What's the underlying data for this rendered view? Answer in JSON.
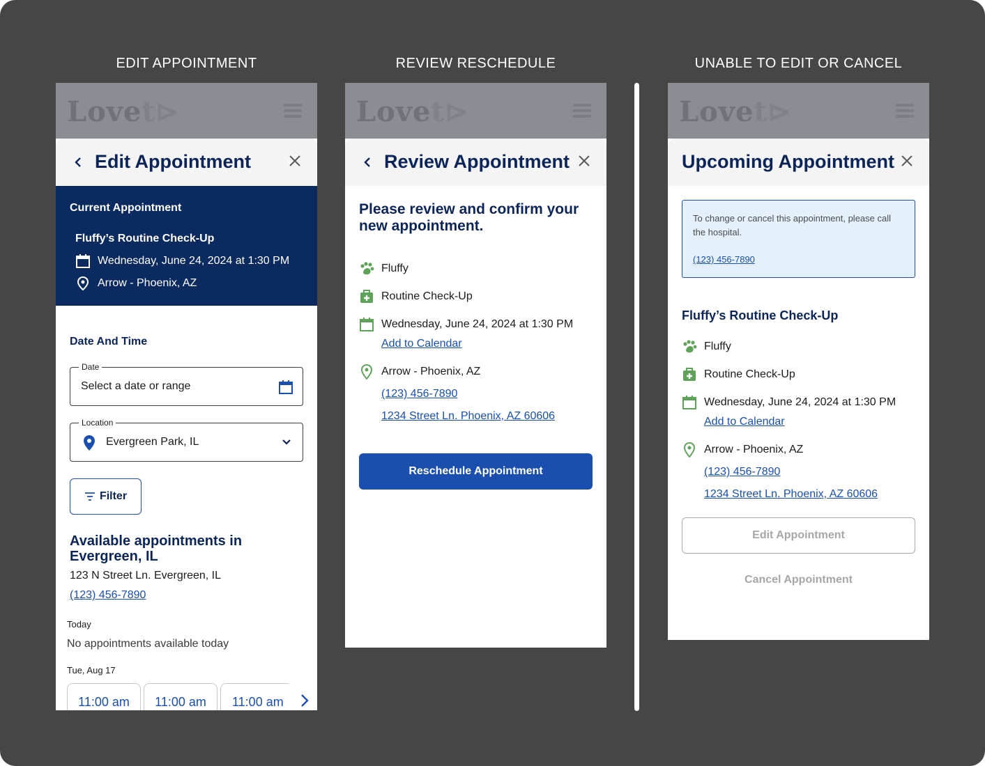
{
  "columns": {
    "edit": "EDIT APPOINTMENT",
    "review": "REVIEW RESCHEDULE",
    "unable": "UNABLE TO EDIT OR CANCEL"
  },
  "brand": {
    "logo_dark": "Love",
    "logo_light": "t",
    "logo_mark": "⊳"
  },
  "edit": {
    "title": "Edit Appointment",
    "current_label": "Current Appointment",
    "appointment_name": "Fluffy’s Routine Check-Up",
    "datetime": "Wednesday, June 24, 2024 at 1:30 PM",
    "location": "Arrow - Phoenix, AZ",
    "section_date_time": "Date And Time",
    "date_field": {
      "label": "Date",
      "placeholder": "Select a date or range"
    },
    "location_field": {
      "label": "Location",
      "value": "Evergreen Park, IL"
    },
    "filter_label": "Filter",
    "available_title": "Available appointments in Evergreen, IL",
    "address": "123 N Street Ln. Evergreen, IL",
    "phone": "(123) 456-7890",
    "today_label": "Today",
    "no_appointments": "No appointments available today",
    "date_label": "Tue, Aug 17",
    "slots": [
      "11:00 am",
      "11:00 am",
      "11:00 am"
    ]
  },
  "review": {
    "title": "Review Appointment",
    "heading": "Please review and confirm your new appointment.",
    "pet": "Fluffy",
    "service": "Routine Check-Up",
    "datetime": "Wednesday, June 24, 2024 at 1:30 PM",
    "add_calendar": "Add to Calendar",
    "location": "Arrow - Phoenix, AZ",
    "phone": "(123) 456-7890",
    "address": "1234 Street Ln. Phoenix, AZ 60606",
    "button": "Reschedule Appointment"
  },
  "unable": {
    "title": "Upcoming Appointment",
    "notice": "To change or cancel this appointment, please call the hospital.",
    "notice_phone": "(123) 456-7890",
    "appointment_name": "Fluffy’s Routine Check-Up",
    "pet": "Fluffy",
    "service": "Routine Check-Up",
    "datetime": "Wednesday, June 24, 2024 at 1:30 PM",
    "add_calendar": "Add to Calendar",
    "location": "Arrow - Phoenix, AZ",
    "phone": "(123) 456-7890",
    "address": "1234 Street Ln. Phoenix, AZ 60606",
    "edit_button": "Edit Appointment",
    "cancel_button": "Cancel Appointment"
  },
  "colors": {
    "navy": "#0b2559",
    "primary": "#1a4fb0",
    "green_icon": "#5fa35a",
    "notice_bg": "#e4f1fc",
    "canvas": "#464646"
  }
}
